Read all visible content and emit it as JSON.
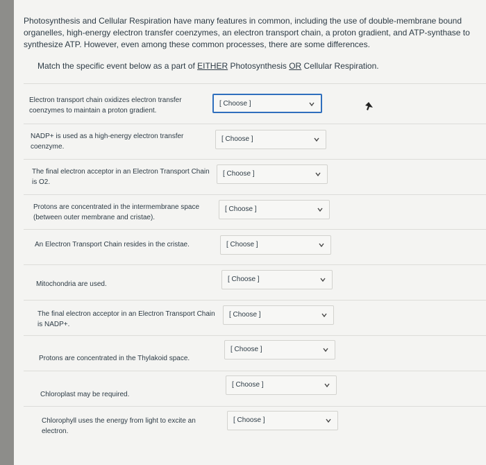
{
  "intro": "Photosynthesis and Cellular Respiration have many features in common, including the use of double-membrane bound organelles, high-energy electron transfer coenzymes, an electron transport chain, a proton gradient, and ATP-synthase to synthesize ATP. However, even among these common processes, there are some differences.",
  "instruction": {
    "before": "Match the specific event below as a part of ",
    "either": "EITHER",
    "middle": " Photosynthesis ",
    "or": "OR",
    "after": " Cellular Respiration."
  },
  "rows": [
    {
      "text": "Electron transport chain oxidizes electron transfer coenzymes to maintain a proton gradient.",
      "select": "[ Choose ]"
    },
    {
      "text": "NADP+ is used as a high-energy electron transfer coenzyme.",
      "select": "[ Choose ]"
    },
    {
      "text": "The final electron acceptor in an Electron Transport Chain is O2.",
      "select": "[ Choose ]"
    },
    {
      "text": "Protons are concentrated in the intermembrane space (between outer membrane and cristae).",
      "select": "[ Choose ]"
    },
    {
      "text": "An Electron Transport Chain resides in the cristae.",
      "select": "[ Choose ]"
    },
    {
      "text": "Mitochondria are used.",
      "select": "[ Choose ]"
    },
    {
      "text": "The final electron acceptor in an Electron Transport Chain is NADP+.",
      "select": "[ Choose ]"
    },
    {
      "text": "Protons are concentrated in the Thylakoid space.",
      "select": "[ Choose ]"
    },
    {
      "text": "Chloroplast may be required.",
      "select": "[ Choose ]"
    },
    {
      "text": "Chlorophyll uses the energy from light to excite an electron.",
      "select": "[ Choose ]"
    }
  ],
  "icons": {
    "dropdown": "chevron-down-icon",
    "cursor": "mouse-pointer-icon"
  },
  "colors": {
    "focus": "#2f6fbd",
    "text": "#2d3b45"
  }
}
